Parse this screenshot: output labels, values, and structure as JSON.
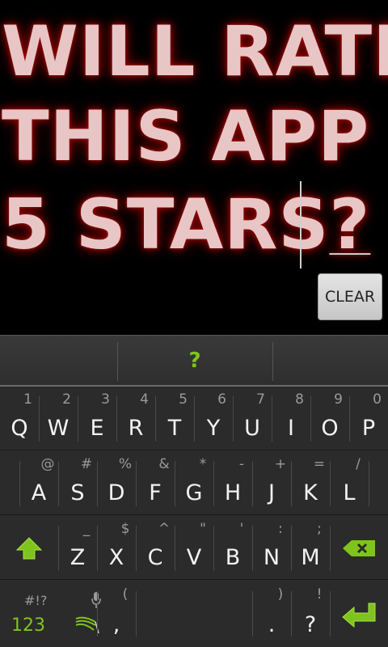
{
  "display": {
    "line_1": "WILL RATE",
    "line_2": "THIS APP",
    "line_3_main": "5 STARS",
    "line_3_last": "?"
  },
  "clear_button": {
    "label": "CLEAR"
  },
  "suggestion_bar": {
    "suggestion": "?"
  },
  "keyboard": {
    "row_1": [
      {
        "hint": "1",
        "main": "Q"
      },
      {
        "hint": "2",
        "main": "W"
      },
      {
        "hint": "3",
        "main": "E"
      },
      {
        "hint": "4",
        "main": "R"
      },
      {
        "hint": "5",
        "main": "T"
      },
      {
        "hint": "6",
        "main": "Y"
      },
      {
        "hint": "7",
        "main": "U"
      },
      {
        "hint": "8",
        "main": "I"
      },
      {
        "hint": "9",
        "main": "O"
      },
      {
        "hint": "0",
        "main": "P"
      }
    ],
    "row_2": [
      {
        "hint": "@",
        "main": "A"
      },
      {
        "hint": "#",
        "main": "S"
      },
      {
        "hint": "%",
        "main": "D"
      },
      {
        "hint": "&",
        "main": "F"
      },
      {
        "hint": "*",
        "main": "G"
      },
      {
        "hint": "-",
        "main": "H"
      },
      {
        "hint": "+",
        "main": "J"
      },
      {
        "hint": "=",
        "main": "K"
      },
      {
        "hint": "/",
        "main": "L"
      }
    ],
    "row_3": [
      {
        "hint": "_",
        "main": "Z"
      },
      {
        "hint": "$",
        "main": "X"
      },
      {
        "hint": "^",
        "main": "C"
      },
      {
        "hint": "\"",
        "main": "V"
      },
      {
        "hint": "'",
        "main": "B"
      },
      {
        "hint": ":",
        "main": "N"
      },
      {
        "hint": ";",
        "main": "M"
      }
    ],
    "row_4": {
      "symbols_top": "#!?",
      "symbols_label": "123",
      "comma_hint": "(",
      "comma_main": ",",
      "period_hint": ")",
      "period_main": ".",
      "question_hint": "!",
      "question_main": "?"
    },
    "accent_color": "#7fc41c",
    "icons": {
      "shift": "shift-arrow-icon",
      "delete": "backspace-icon",
      "mic": "microphone-icon",
      "swype": "swype-logo-icon",
      "enter": "enter-arrow-icon"
    }
  }
}
